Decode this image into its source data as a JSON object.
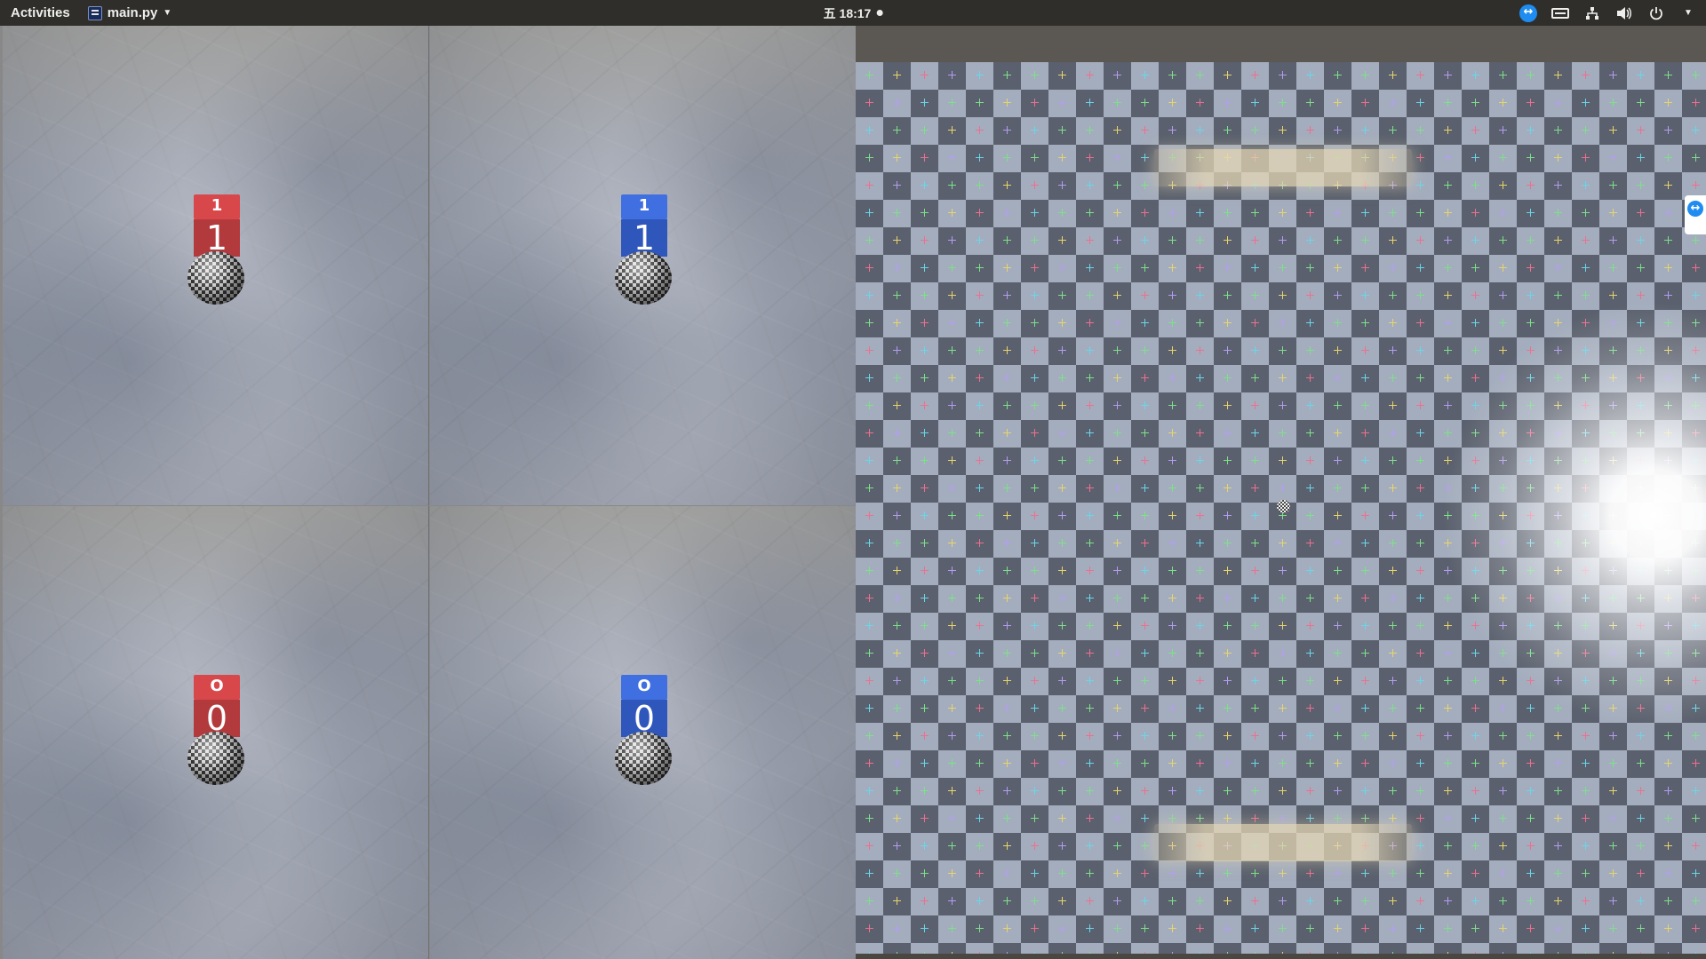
{
  "topbar": {
    "activities_label": "Activities",
    "app_name": "main.py",
    "clock": "五 18:17"
  },
  "viewports": [
    {
      "position": "top-left",
      "marker_color": "red",
      "top_label": "1",
      "front_label": "1"
    },
    {
      "position": "top-right",
      "marker_color": "blue",
      "top_label": "1",
      "front_label": "1"
    },
    {
      "position": "bottom-left",
      "marker_color": "red",
      "top_label": "O",
      "front_label": "0"
    },
    {
      "position": "bottom-right",
      "marker_color": "blue",
      "top_label": "O",
      "front_label": "0"
    }
  ],
  "colors": {
    "topbar_bg": "#2f2e2b",
    "red_marker": "#d8474a",
    "blue_marker": "#3f6fe0",
    "teamviewer_blue": "#1e8cf0"
  },
  "tray_icons": [
    "teamviewer-icon",
    "keyboard-icon",
    "network-icon",
    "volume-icon",
    "power-icon",
    "chevron-down-icon"
  ]
}
